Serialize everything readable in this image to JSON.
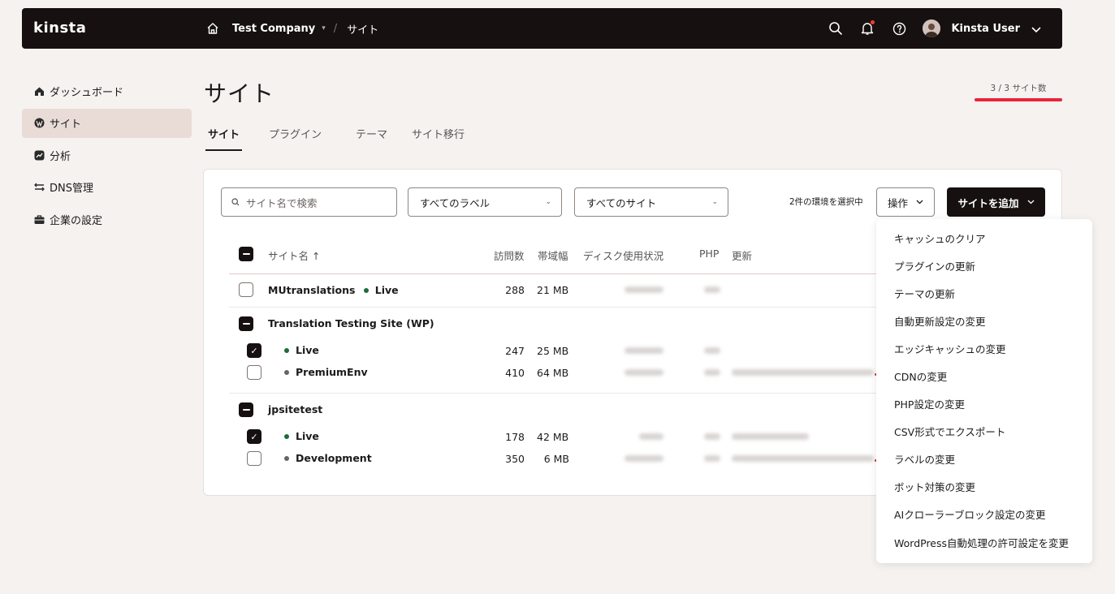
{
  "brand": {
    "logo": "kinsta"
  },
  "topbar": {
    "company": "Test Company",
    "current": "サイト",
    "separator": "/",
    "user": "Kinsta User"
  },
  "sidebar": {
    "items": [
      {
        "label": "ダッシュボード",
        "icon": "home-icon"
      },
      {
        "label": "サイト",
        "icon": "wordpress-icon",
        "active": true
      },
      {
        "label": "分析",
        "icon": "chart-icon"
      },
      {
        "label": "DNS管理",
        "icon": "dns-icon"
      },
      {
        "label": "企業の設定",
        "icon": "briefcase-icon"
      }
    ]
  },
  "page": {
    "title": "サイト",
    "site_count": "3 / 3 サイト数"
  },
  "tabs": [
    "サイト",
    "プラグイン",
    "テーマ",
    "サイト移行"
  ],
  "toolbar": {
    "search_placeholder": "サイト名で検索",
    "label_filter": "すべてのラベル",
    "site_filter": "すべてのサイト",
    "selected_info": "2件の環境を選択中",
    "actions_label": "操作",
    "add_site_label": "サイトを追加"
  },
  "table": {
    "headers": {
      "name": "サイト名 ↑",
      "visits": "訪問数",
      "bandwidth": "帯域幅",
      "disk": "ディスク使用状況",
      "php": "PHP",
      "updates": "更新"
    },
    "sites": [
      {
        "name": "MUtranslations",
        "env": "Live",
        "visits": "288",
        "bandwidth": "21 MB"
      },
      {
        "name": "Translation Testing Site (WP)",
        "envs": [
          {
            "name": "Live",
            "visits": "247",
            "bandwidth": "25 MB",
            "checked": true
          },
          {
            "name": "PremiumEnv",
            "visits": "410",
            "bandwidth": "64 MB",
            "checked": false
          }
        ]
      },
      {
        "name": "jpsitetest",
        "envs": [
          {
            "name": "Live",
            "visits": "178",
            "bandwidth": "42 MB",
            "checked": true
          },
          {
            "name": "Development",
            "visits": "350",
            "bandwidth": "6 MB",
            "checked": false
          }
        ]
      }
    ]
  },
  "menu": {
    "items": [
      "キャッシュのクリア",
      "プラグインの更新",
      "テーマの更新",
      "自動更新設定の変更",
      "エッジキャッシュの変更",
      "CDNの変更",
      "PHP設定の変更",
      "CSV形式でエクスポート",
      "ラベルの変更",
      "ボット対策の変更",
      "AIクローラーブロック設定の変更",
      "WordPress自動処理の許可設定を変更"
    ]
  },
  "colors": {
    "topbar_bg": "#161010",
    "page_bg": "#f6f2f0",
    "accent_red": "#e8253b",
    "live_green": "#1d6b3a",
    "sidebar_active": "#e9dcd6"
  }
}
